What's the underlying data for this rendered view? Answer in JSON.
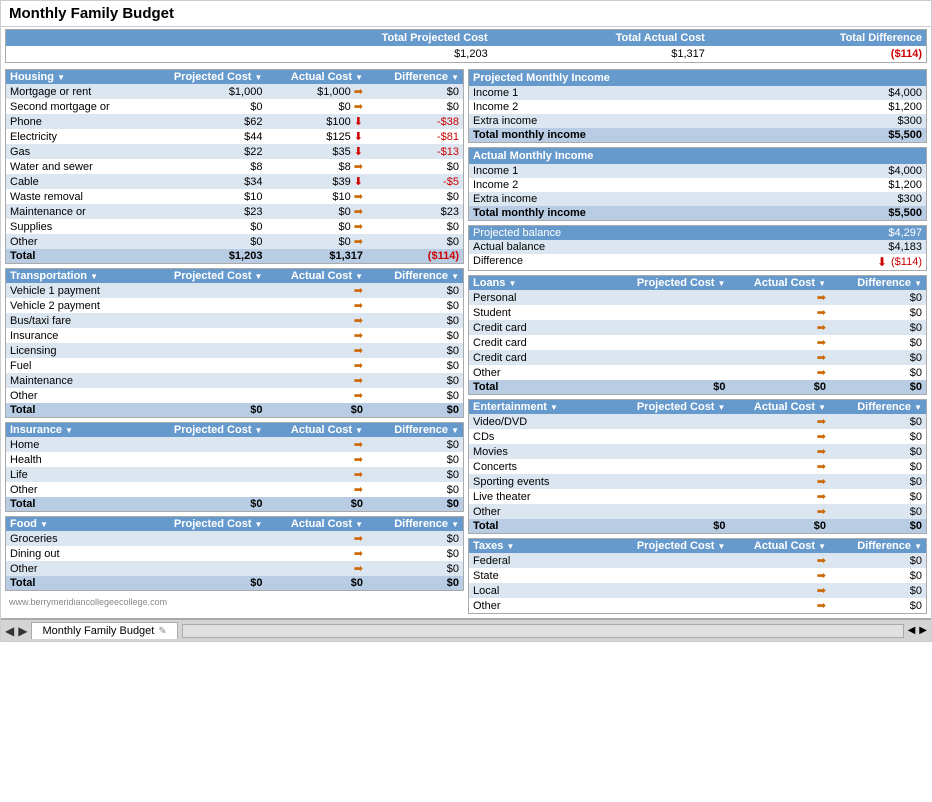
{
  "title": "Monthly Family Budget",
  "summary_top": {
    "col1": "Total Projected Cost",
    "col2": "Total Actual Cost",
    "col3": "Total Difference",
    "val1": "$1,203",
    "val2": "$1,317",
    "val3": "($114)"
  },
  "housing": {
    "header": "Housing",
    "col_projected": "Projected Cost",
    "col_actual": "Actual Cost",
    "col_diff": "Difference",
    "rows": [
      {
        "label": "Mortgage or rent",
        "projected": "$1,000",
        "actual": "$1,000",
        "diff": "$0",
        "diff_neg": false
      },
      {
        "label": "Second mortgage or",
        "projected": "$0",
        "actual": "$0",
        "diff": "$0",
        "diff_neg": false
      },
      {
        "label": "Phone",
        "projected": "$62",
        "actual": "$100",
        "diff": "-$38",
        "diff_neg": true
      },
      {
        "label": "Electricity",
        "projected": "$44",
        "actual": "$125",
        "diff": "-$81",
        "diff_neg": true
      },
      {
        "label": "Gas",
        "projected": "$22",
        "actual": "$35",
        "diff": "-$13",
        "diff_neg": true
      },
      {
        "label": "Water and sewer",
        "projected": "$8",
        "actual": "$8",
        "diff": "$0",
        "diff_neg": false
      },
      {
        "label": "Cable",
        "projected": "$34",
        "actual": "$39",
        "diff": "-$5",
        "diff_neg": true
      },
      {
        "label": "Waste removal",
        "projected": "$10",
        "actual": "$10",
        "diff": "$0",
        "diff_neg": false
      },
      {
        "label": "Maintenance or",
        "projected": "$23",
        "actual": "$0",
        "diff": "$23",
        "diff_neg": false
      },
      {
        "label": "Supplies",
        "projected": "$0",
        "actual": "$0",
        "diff": "$0",
        "diff_neg": false
      },
      {
        "label": "Other",
        "projected": "$0",
        "actual": "$0",
        "diff": "$0",
        "diff_neg": false
      }
    ],
    "total_label": "Total",
    "total_projected": "$1,203",
    "total_actual": "$1,317",
    "total_diff": "($114)",
    "total_diff_neg": true
  },
  "transportation": {
    "header": "Transportation",
    "rows": [
      {
        "label": "Vehicle 1 payment"
      },
      {
        "label": "Vehicle 2 payment"
      },
      {
        "label": "Bus/taxi fare"
      },
      {
        "label": "Insurance"
      },
      {
        "label": "Licensing"
      },
      {
        "label": "Fuel"
      },
      {
        "label": "Maintenance"
      },
      {
        "label": "Other"
      }
    ],
    "total_projected": "$0",
    "total_actual": "$0",
    "total_diff": "$0"
  },
  "insurance": {
    "header": "Insurance",
    "rows": [
      {
        "label": "Home"
      },
      {
        "label": "Health"
      },
      {
        "label": "Life"
      },
      {
        "label": "Other"
      }
    ],
    "total_projected": "$0",
    "total_actual": "$0",
    "total_diff": "$0"
  },
  "food": {
    "header": "Food",
    "rows": [
      {
        "label": "Groceries"
      },
      {
        "label": "Dining out"
      },
      {
        "label": "Other"
      }
    ],
    "total_projected": "$0",
    "total_actual": "$0",
    "total_diff": "$0"
  },
  "projected_income": {
    "header": "Projected Monthly Income",
    "rows": [
      {
        "label": "Income 1",
        "value": "$4,000"
      },
      {
        "label": "Income 2",
        "value": "$1,200"
      },
      {
        "label": "Extra income",
        "value": "$300"
      }
    ],
    "total_label": "Total monthly income",
    "total_value": "$5,500"
  },
  "actual_income": {
    "header": "Actual Monthly Income",
    "rows": [
      {
        "label": "Income 1",
        "value": "$4,000"
      },
      {
        "label": "Income 2",
        "value": "$1,200"
      },
      {
        "label": "Extra income",
        "value": "$300"
      }
    ],
    "total_label": "Total monthly income",
    "total_value": "$5,500"
  },
  "balance": {
    "projected_label": "Projected balance",
    "projected_value": "$4,297",
    "actual_label": "Actual balance",
    "actual_value": "$4,183",
    "diff_label": "Difference",
    "diff_value": "($114)"
  },
  "loans": {
    "header": "Loans",
    "col_projected": "Projected Cost",
    "col_actual": "Actual Cost",
    "col_diff": "Difference",
    "rows": [
      {
        "label": "Personal"
      },
      {
        "label": "Student"
      },
      {
        "label": "Credit card"
      },
      {
        "label": "Credit card"
      },
      {
        "label": "Credit card"
      },
      {
        "label": "Other"
      }
    ],
    "total_projected": "$0",
    "total_actual": "$0",
    "total_diff": "$0"
  },
  "entertainment": {
    "header": "Entertainment",
    "col_projected": "Projected Cost",
    "col_actual": "Actual Cost",
    "col_diff": "Difference",
    "rows": [
      {
        "label": "Video/DVD"
      },
      {
        "label": "CDs"
      },
      {
        "label": "Movies"
      },
      {
        "label": "Concerts"
      },
      {
        "label": "Sporting events"
      },
      {
        "label": "Live theater"
      },
      {
        "label": "Other"
      }
    ],
    "total_projected": "$0",
    "total_actual": "$0",
    "total_diff": "$0"
  },
  "taxes": {
    "header": "Taxes",
    "col_projected": "Projected Cost",
    "col_actual": "Actual Cost",
    "col_diff": "Difference",
    "rows": [
      {
        "label": "Federal"
      },
      {
        "label": "State"
      },
      {
        "label": "Local"
      },
      {
        "label": "Other"
      }
    ]
  },
  "tab": {
    "label": "Monthly Family Budget"
  },
  "watermark": "www.berrymeridiancollegeecollege.com"
}
